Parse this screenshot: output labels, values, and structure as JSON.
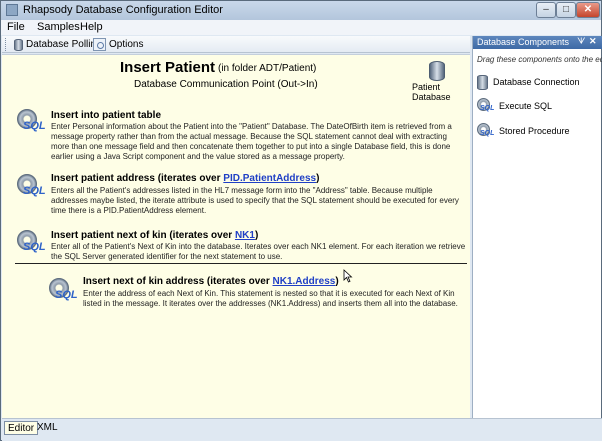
{
  "window": {
    "title": "Rhapsody Database Configuration Editor"
  },
  "menu": [
    "File",
    "Samples",
    "Help"
  ],
  "toolbar": {
    "polling": "Database Polling",
    "options": "Options"
  },
  "header": {
    "title": "Insert Patient",
    "folder": "(in folder ADT/Patient)",
    "subtitle": "Database Communication Point (Out->In)",
    "db_label": "Patient Database"
  },
  "blocks": [
    {
      "title": "Insert into patient table",
      "link": "",
      "suffix": "",
      "desc": "Enter Personal information about the Patient into the \"Patient\" Database. The DateOfBirth item is retrieved from a message property rather than from the actual message. Because the SQL statement cannot deal with extracting more than one message field and then concatenate them together to put into a single Database field, this is done earlier using a Java Script component and the value stored as a message property."
    },
    {
      "title": "Insert patient address (iterates over ",
      "link": "PID.PatientAddress",
      "suffix": ")",
      "desc": "Enters all the Patient's addresses listed in the HL7 message form into the \"Address\" table. Because multiple addresses maybe listed, the iterate attribute is used to specify that the SQL statement should be executed for every time there is a PID.PatientAddress element."
    },
    {
      "title": "Insert patient next of kin (iterates over ",
      "link": "NK1",
      "suffix": ")",
      "desc": "Enter all of the Patient's Next of Kin into the database. Iterates over each NK1 element. For each iteration we retrieve the SQL Server generated identifier for the next statement to use."
    },
    {
      "title": "Insert next of kin address (iterates over ",
      "link": "NK1.Address",
      "suffix": ")",
      "desc": "Enter the address of each Next of Kin. This statement is nested so that it is executed for each Next of Kin listed in the message. It iterates over the addresses (NK1.Address) and inserts them all into the database."
    }
  ],
  "side": {
    "title": "Database Components",
    "hint": "Drag these components onto the editor",
    "items": [
      "Database Connection",
      "Execute SQL",
      "Stored Procedure"
    ]
  },
  "tabs": [
    "Editor",
    "XML"
  ]
}
